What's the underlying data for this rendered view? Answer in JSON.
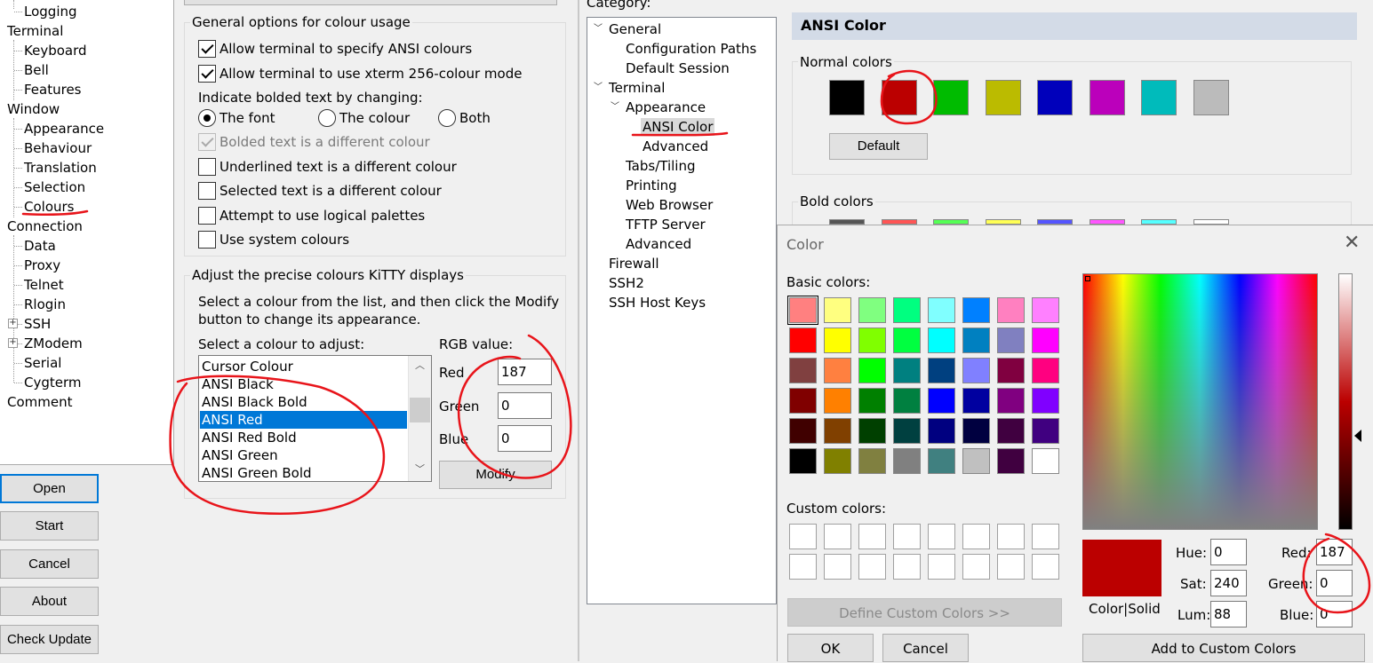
{
  "left_tree": {
    "items": [
      {
        "label": "Logging",
        "level": 1
      },
      {
        "label": "Terminal",
        "level": 0
      },
      {
        "label": "Keyboard",
        "level": 1
      },
      {
        "label": "Bell",
        "level": 1
      },
      {
        "label": "Features",
        "level": 1
      },
      {
        "label": "Window",
        "level": 0
      },
      {
        "label": "Appearance",
        "level": 1
      },
      {
        "label": "Behaviour",
        "level": 1
      },
      {
        "label": "Translation",
        "level": 1
      },
      {
        "label": "Selection",
        "level": 1
      },
      {
        "label": "Colours",
        "level": 1
      },
      {
        "label": "Connection",
        "level": 0
      },
      {
        "label": "Data",
        "level": 1
      },
      {
        "label": "Proxy",
        "level": 1
      },
      {
        "label": "Telnet",
        "level": 1
      },
      {
        "label": "Rlogin",
        "level": 1
      },
      {
        "label": "SSH",
        "level": 1
      },
      {
        "label": "ZModem",
        "level": 1
      },
      {
        "label": "Serial",
        "level": 1
      },
      {
        "label": "Cygterm",
        "level": 1
      },
      {
        "label": "Comment",
        "level": 0
      }
    ]
  },
  "side_buttons": {
    "open": "Open",
    "start": "Start",
    "cancel": "Cancel",
    "about": "About",
    "check_update": "Check Update"
  },
  "general_options": {
    "title": "General options for colour usage",
    "allow_ansi": "Allow terminal to specify ANSI colours",
    "allow_256": "Allow terminal to use xterm 256-colour mode",
    "bold_prompt": "Indicate bolded text by changing:",
    "radio_font": "The font",
    "radio_colour": "The colour",
    "radio_both": "Both",
    "bolded_diff": "Bolded text is a different colour",
    "underlined_diff": "Underlined text is a different colour",
    "selected_diff": "Selected text is a different colour",
    "logical_palettes": "Attempt to use logical palettes",
    "system_colours": "Use system colours"
  },
  "adjust": {
    "title": "Adjust the precise colours KiTTY displays",
    "instructions_1": "Select a colour from the list, and then click the Modify",
    "instructions_2": "button to change its appearance.",
    "list_label": "Select a colour to adjust:",
    "list_items": [
      "Cursor Colour",
      "ANSI Black",
      "ANSI Black Bold",
      "ANSI Red",
      "ANSI Red Bold",
      "ANSI Green",
      "ANSI Green Bold"
    ],
    "rgb_label": "RGB value:",
    "red_label": "Red",
    "green_label": "Green",
    "blue_label": "Blue",
    "red_value": "187",
    "green_value": "0",
    "blue_value": "0",
    "modify": "Modify"
  },
  "category": {
    "label": "Category:",
    "items": [
      "General",
      "Configuration Paths",
      "Default Session",
      "Terminal",
      "Appearance",
      "ANSI Color",
      "Advanced",
      "Tabs/Tiling",
      "Printing",
      "Web Browser",
      "TFTP Server",
      "Advanced",
      "Firewall",
      "SSH2",
      "SSH Host Keys"
    ]
  },
  "ansi": {
    "header": "ANSI Color",
    "normal_label": "Normal colors",
    "normal_swatches": [
      "#000000",
      "#bb0000",
      "#00bb00",
      "#bbbb00",
      "#0000bb",
      "#bb00bb",
      "#00bbbb",
      "#bbbbbb"
    ],
    "default": "Default",
    "bold_label": "Bold colors",
    "bold_swatches": [
      "#555555",
      "#ff5555",
      "#55ff55",
      "#ffff55",
      "#5555ff",
      "#ff55ff",
      "#55ffff",
      "#ffffff"
    ]
  },
  "color_dialog": {
    "title": "Color",
    "basic_label": "Basic colors:",
    "basic_colors": [
      "#ff8080",
      "#ffff80",
      "#80ff80",
      "#00ff80",
      "#80ffff",
      "#0080ff",
      "#ff80c0",
      "#ff80ff",
      "#ff0000",
      "#ffff00",
      "#80ff00",
      "#00ff40",
      "#00ffff",
      "#0080c0",
      "#8080c0",
      "#ff00ff",
      "#804040",
      "#ff8040",
      "#00ff00",
      "#008080",
      "#004080",
      "#8080ff",
      "#800040",
      "#ff0080",
      "#800000",
      "#ff8000",
      "#008000",
      "#008040",
      "#0000ff",
      "#0000a0",
      "#800080",
      "#8000ff",
      "#400000",
      "#804000",
      "#004000",
      "#004040",
      "#000080",
      "#000040",
      "#400040",
      "#400080",
      "#000000",
      "#808000",
      "#808040",
      "#808080",
      "#408080",
      "#c0c0c0",
      "#400040",
      "#ffffff"
    ],
    "custom_label": "Custom colors:",
    "define_custom": "Define Custom Colors >>",
    "ok": "OK",
    "cancel": "Cancel",
    "hue_label": "Hue:",
    "sat_label": "Sat:",
    "lum_label": "Lum:",
    "red_label": "Red:",
    "green_label": "Green:",
    "blue_label": "Blue:",
    "hue": "0",
    "sat": "240",
    "lum": "88",
    "red": "187",
    "green": "0",
    "blue": "0",
    "color_solid": "Color|Solid",
    "preview_color": "#bb0000",
    "add_custom": "Add to Custom Colors"
  }
}
